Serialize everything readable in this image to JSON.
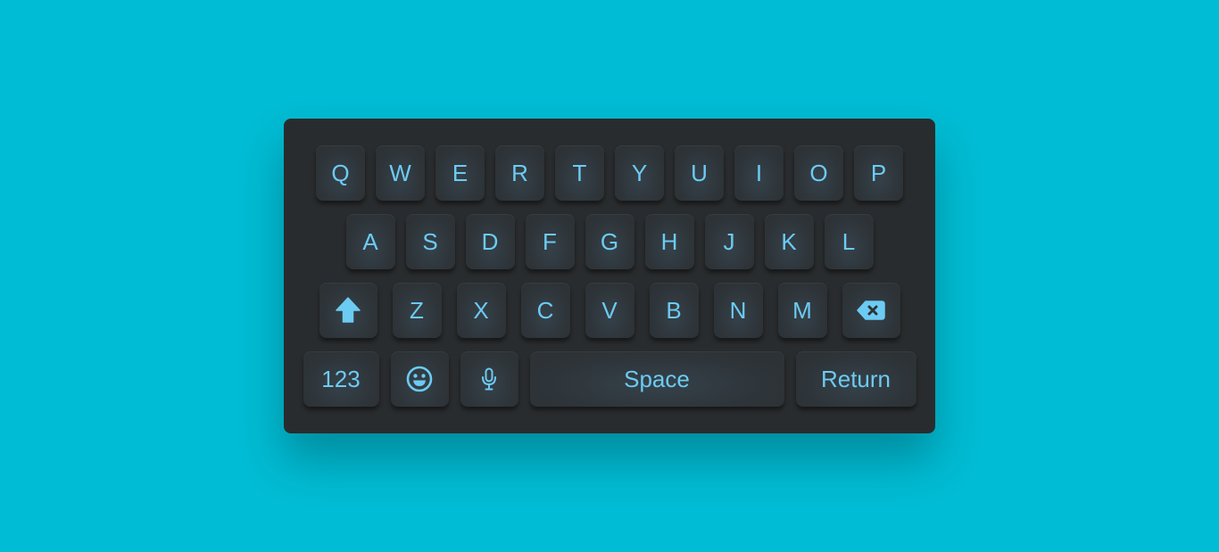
{
  "colors": {
    "background": "#00bcd4",
    "keyboard": "#292c2e",
    "key": "#2f3539",
    "key_text": "#6ccbf2"
  },
  "keyboard": {
    "row1": [
      "Q",
      "W",
      "E",
      "R",
      "T",
      "Y",
      "U",
      "I",
      "O",
      "P"
    ],
    "row2": [
      "A",
      "S",
      "D",
      "F",
      "G",
      "H",
      "J",
      "K",
      "L"
    ],
    "row3": [
      "Z",
      "X",
      "C",
      "V",
      "B",
      "N",
      "M"
    ],
    "row3_icons": {
      "left": "shift-icon",
      "right": "backspace-icon"
    },
    "bottom": {
      "numbers_label": "123",
      "emoji_icon": "emoji-icon",
      "mic_icon": "microphone-icon",
      "space_label": "Space",
      "return_label": "Return"
    }
  }
}
